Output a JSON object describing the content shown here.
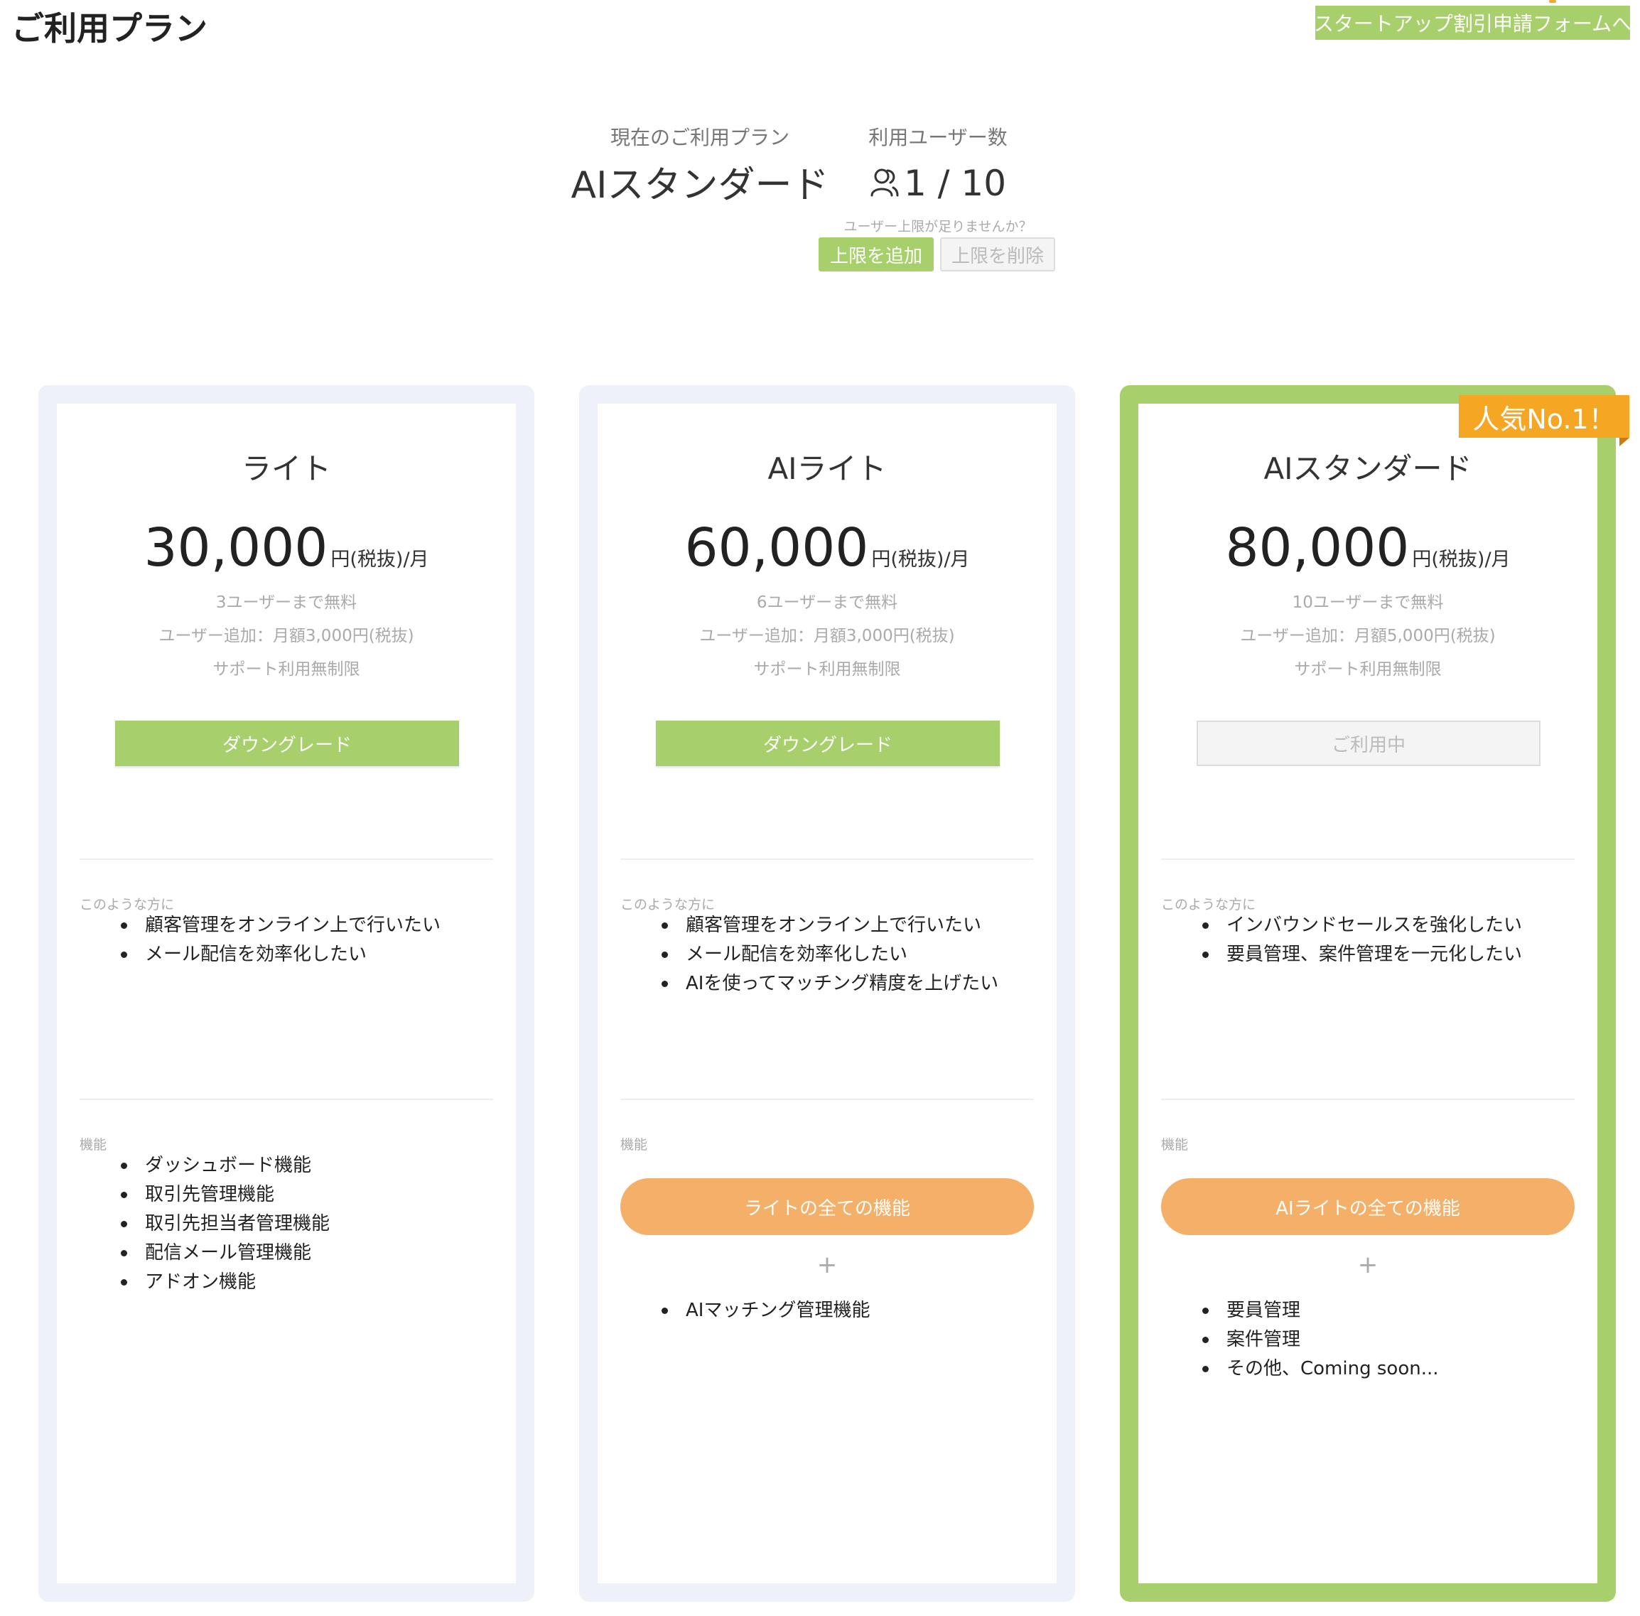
{
  "header": {
    "title": "ご利用プラン",
    "startup_link": "スタートアップ割引申請フォームへ"
  },
  "current_plan": {
    "label": "現在のご利用プラン",
    "name": "AIスタンダード"
  },
  "users": {
    "label": "利用ユーザー数",
    "icon": "user-icon",
    "count": "1 / 10",
    "hint": "ユーザー上限が足りませんか？",
    "add_button": "上限を追加",
    "remove_button": "上限を削除"
  },
  "colors": {
    "green": "#a7d06c",
    "orange": "#f4b069",
    "badge": "#f5a623",
    "card_border": "#eef1fa"
  },
  "plans": [
    {
      "name": "ライト",
      "price": "30,000",
      "unit": "円(税抜)/月",
      "notes": [
        "3ユーザーまで無料",
        "ユーザー追加：月額3,000円(税抜)",
        "サポート利用無制限"
      ],
      "button": "ダウングレード",
      "audience_label": "このような方に",
      "audience": [
        "顧客管理をオンライン上で行いたい",
        "メール配信を効率化したい"
      ],
      "features_label": "機能",
      "features": [
        "ダッシュボード機能",
        "取引先管理機能",
        "取引先担当者管理機能",
        "配信メール管理機能",
        "アドオン機能"
      ]
    },
    {
      "name": "AIライト",
      "price": "60,000",
      "unit": "円(税抜)/月",
      "notes": [
        "6ユーザーまで無料",
        "ユーザー追加：月額3,000円(税抜)",
        "サポート利用無制限"
      ],
      "button": "ダウングレード",
      "audience_label": "このような方に",
      "audience": [
        "顧客管理をオンライン上で行いたい",
        "メール配信を効率化したい",
        "AIを使ってマッチング精度を上げたい"
      ],
      "features_label": "機能",
      "features_pill": "ライトの全ての機能",
      "plus": "+",
      "features": [
        "AIマッチング管理機能"
      ]
    },
    {
      "name": "AIスタンダード",
      "price": "80,000",
      "unit": "円(税抜)/月",
      "notes": [
        "10ユーザーまで無料",
        "ユーザー追加：月額5,000円(税抜)",
        "サポート利用無制限"
      ],
      "button": "ご利用中",
      "badge": "人気No.1！",
      "audience_label": "このような方に",
      "audience": [
        "インバウンドセールスを強化したい",
        "要員管理、案件管理を一元化したい"
      ],
      "features_label": "機能",
      "features_pill": "AIライトの全ての機能",
      "plus": "+",
      "features": [
        "要員管理",
        "案件管理",
        "その他、Coming soon..."
      ]
    }
  ]
}
